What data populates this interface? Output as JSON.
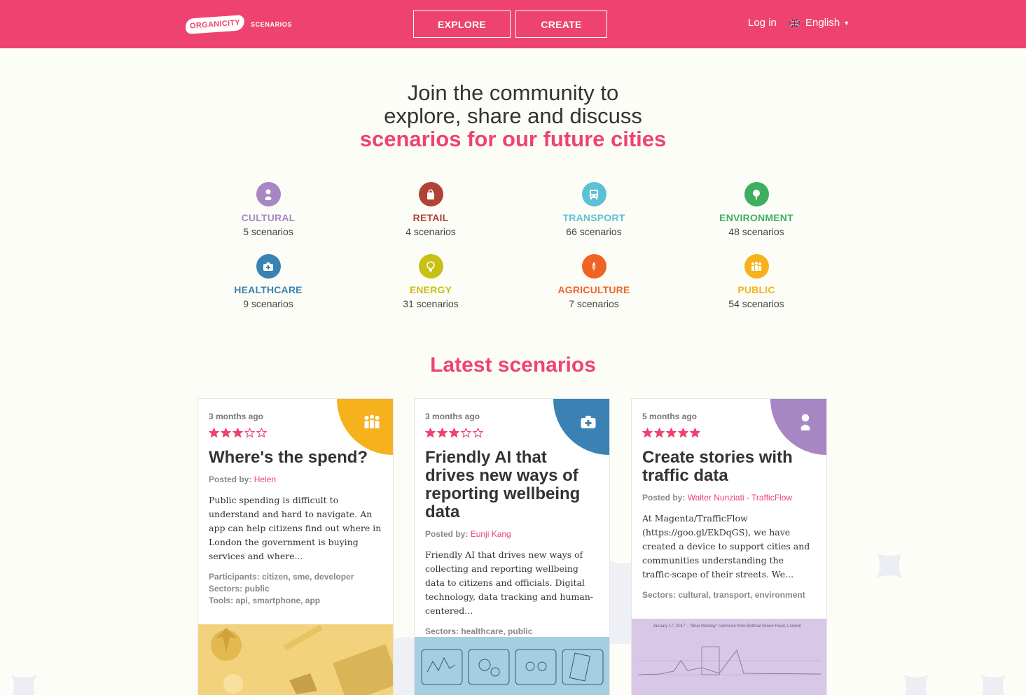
{
  "header": {
    "logo_badge": "ORGANICITY",
    "logo_sub": "SCENARIOS",
    "nav": {
      "explore": "EXPLORE",
      "create": "CREATE"
    },
    "login": "Log in",
    "language": "English"
  },
  "hero": {
    "line1": "Join the community to",
    "line2": "explore, share and discuss",
    "accent": "scenarios for our future cities"
  },
  "colors": {
    "brand": "#ee4370",
    "cultural": "#a687c3",
    "retail": "#b04237",
    "transport": "#5ec0d4",
    "environment": "#3eae5f",
    "healthcare": "#3a82b3",
    "energy": "#c8c014",
    "agriculture": "#ef6424",
    "public": "#f5b21c"
  },
  "categories": [
    {
      "name": "CULTURAL",
      "count": "5 scenarios",
      "icon": "bust-icon"
    },
    {
      "name": "RETAIL",
      "count": "4 scenarios",
      "icon": "shopping-bag-icon"
    },
    {
      "name": "TRANSPORT",
      "count": "66 scenarios",
      "icon": "bus-icon"
    },
    {
      "name": "ENVIRONMENT",
      "count": "48 scenarios",
      "icon": "tree-icon"
    },
    {
      "name": "HEALTHCARE",
      "count": "9 scenarios",
      "icon": "first-aid-icon"
    },
    {
      "name": "ENERGY",
      "count": "31 scenarios",
      "icon": "lightbulb-icon"
    },
    {
      "name": "AGRICULTURE",
      "count": "7 scenarios",
      "icon": "wheat-icon"
    },
    {
      "name": "PUBLIC",
      "count": "54 scenarios",
      "icon": "people-icon"
    }
  ],
  "latest_title": "Latest scenarios",
  "cards": [
    {
      "time": "3 months ago",
      "rating": 3,
      "title": "Where's the spend?",
      "posted_label": "Posted by:",
      "author": "Helen",
      "excerpt": "Public spending is difficult to understand and hard to navigate. An app can help citizens find out where in London the government is buying services and where...",
      "meta": [
        "Participants: citizen, sme, developer",
        "Sectors: public",
        "Tools: api, smartphone, app"
      ],
      "sector_icon": "people-icon"
    },
    {
      "time": "3 months ago",
      "rating": 3,
      "title": "Friendly AI that drives new ways of reporting wellbeing data",
      "posted_label": "Posted by:",
      "author": "Eunji Kang",
      "excerpt": "Friendly AI that drives new ways of collecting and reporting wellbeing data to citizens and officials. Digital technology, data tracking and human-centered...",
      "meta": [
        "Sectors: healthcare, public"
      ],
      "sector_icon": "first-aid-icon"
    },
    {
      "time": "5 months ago",
      "rating": 5,
      "title": "Create stories with traffic data",
      "posted_label": "Posted by:",
      "author": "Walter Nunziati - TrafficFlow",
      "excerpt": "At Magenta/TrafficFlow (https://goo.gl/EkDqGS), we have created a device to support cities and communities understanding the traffic-scape of their streets. We...",
      "meta": [
        "Sectors: cultural, transport, environment"
      ],
      "sector_icon": "bust-icon",
      "thumb_caption": "January 17, 2017 – \"Blue Monday\" commute from Bethnal Green Road, London"
    }
  ]
}
